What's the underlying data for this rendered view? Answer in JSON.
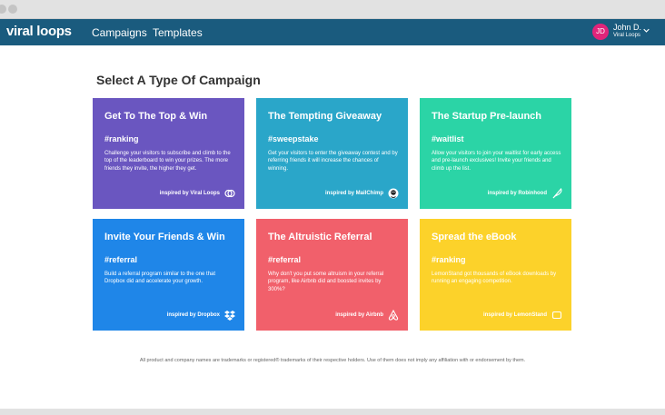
{
  "colors": {
    "navbar": "#1a5b7e",
    "avatar": "#e0247a",
    "purple": "#6a56c0",
    "teal": "#2aa6c9",
    "green": "#2bd4a6",
    "blue": "#1f86e8",
    "coral": "#f1606b",
    "yellow": "#fcd22a"
  },
  "nav": {
    "logo": "viral loops",
    "links": [
      "Campaigns",
      "Templates"
    ],
    "user": {
      "initials": "JD",
      "name": "John D.",
      "org": "Viral Loops"
    }
  },
  "page": {
    "heading": "Select A Type Of Campaign"
  },
  "cards": [
    {
      "title": "Get To The Top & Win",
      "tag": "#ranking",
      "desc": "Challenge your visitors to subscribe and climb to the top of the leaderboard to win your prizes. The more friends they invite, the higher they get.",
      "inspired": "inspired by Viral Loops",
      "icon": "viral-loops-logo-icon"
    },
    {
      "title": "The Tempting Giveaway",
      "tag": "#sweepstake",
      "desc": "Get your visitors to enter the giveaway contest and by referring friends it will increase the chances of winning.",
      "inspired": "inspired by MailChimp",
      "icon": "mailchimp-logo-icon"
    },
    {
      "title": "The Startup Pre-launch",
      "tag": "#waitlist",
      "desc": "Allow your visitors to join your waitlist for early access and pre-launch exclusives! Invite your friends and climb up the list.",
      "inspired": "inspired by Robinhood",
      "icon": "robinhood-feather-icon"
    },
    {
      "title": "Invite Your Friends & Win",
      "tag": "#referral",
      "desc": "Build a referral program similar to the one that Dropbox did and accelerate your growth.",
      "inspired": "inspired by Dropbox",
      "icon": "dropbox-logo-icon"
    },
    {
      "title": "The Altruistic Referral",
      "tag": "#referral",
      "desc": "Why don't you put some altruism in your referral program, like Airbnb did and boosted invites by 300%?",
      "inspired": "inspired by Airbnb",
      "icon": "airbnb-logo-icon"
    },
    {
      "title": "Spread the eBook",
      "tag": "#ranking",
      "desc": "LemonStand got thousands of eBook downloads by running an engaging competition.",
      "inspired": "inspired by LemonStand",
      "icon": "lemonstand-logo-icon"
    }
  ],
  "footer": {
    "disclaimer": "All product and company names are trademarks or registered® trademarks of their respective holders. Use of them does not imply any affiliation with or endorsement by them."
  }
}
